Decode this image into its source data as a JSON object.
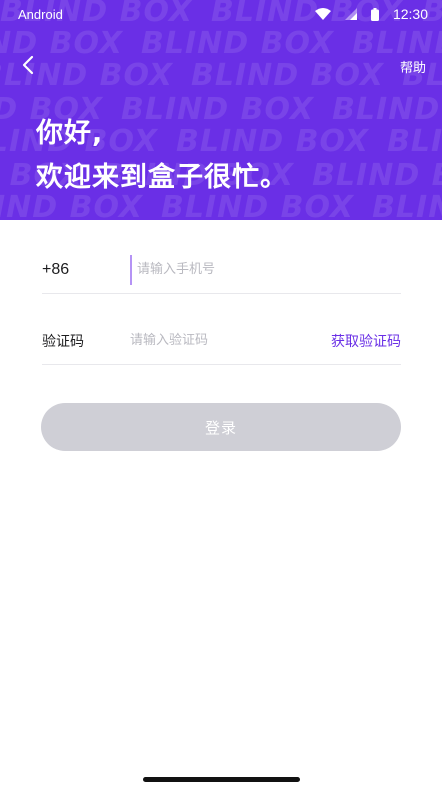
{
  "status_bar": {
    "label": "Android",
    "time": "12:30",
    "icons": [
      "wifi-icon",
      "signal-icon",
      "battery-icon"
    ]
  },
  "header": {
    "pattern_text": "BLIND BOX",
    "help_label": "帮助",
    "greeting_line1": "你好,",
    "greeting_line2": "欢迎来到盒子很忙。",
    "background_color": "#6a2fe6"
  },
  "form": {
    "phone_prefix": "+86",
    "phone_placeholder": "请输入手机号",
    "phone_value": "",
    "code_label": "验证码",
    "code_placeholder": "请输入验证码",
    "code_value": "",
    "get_code_label": "获取验证码",
    "login_label": "登录",
    "accent_color": "#6a2fe6",
    "disabled_button_color": "#cfcfd6"
  }
}
